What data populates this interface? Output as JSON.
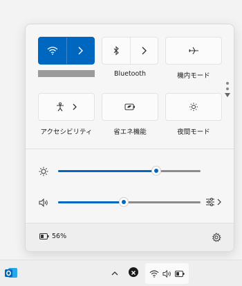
{
  "quick_settings": {
    "tiles": [
      {
        "id": "wifi",
        "label": "",
        "active": true,
        "icon": "wifi-icon"
      },
      {
        "id": "bluetooth",
        "label": "Bluetooth",
        "active": false,
        "icon": "bluetooth-icon"
      },
      {
        "id": "airplane",
        "label": "機内モード",
        "active": false,
        "icon": "airplane-icon"
      },
      {
        "id": "accessibility",
        "label": "アクセシビリティ",
        "active": false,
        "icon": "accessibility-icon"
      },
      {
        "id": "battery-saver",
        "label": "省エネ機能",
        "active": false,
        "icon": "battery-saver-icon"
      },
      {
        "id": "night-light",
        "label": "夜間モード",
        "active": false,
        "icon": "night-light-icon"
      }
    ],
    "brightness": {
      "value": 0.69,
      "icon": "brightness-icon"
    },
    "volume": {
      "value": 0.46,
      "icon": "volume-icon"
    },
    "battery": {
      "text": "56%",
      "icon": "battery-icon"
    }
  },
  "colors": {
    "accent": "#0067c0",
    "panel": "#f6f6f6"
  },
  "taskbar": {
    "apps": [
      "outlook-icon"
    ],
    "tray_icons": [
      "wifi-icon",
      "volume-icon",
      "battery-icon"
    ]
  }
}
